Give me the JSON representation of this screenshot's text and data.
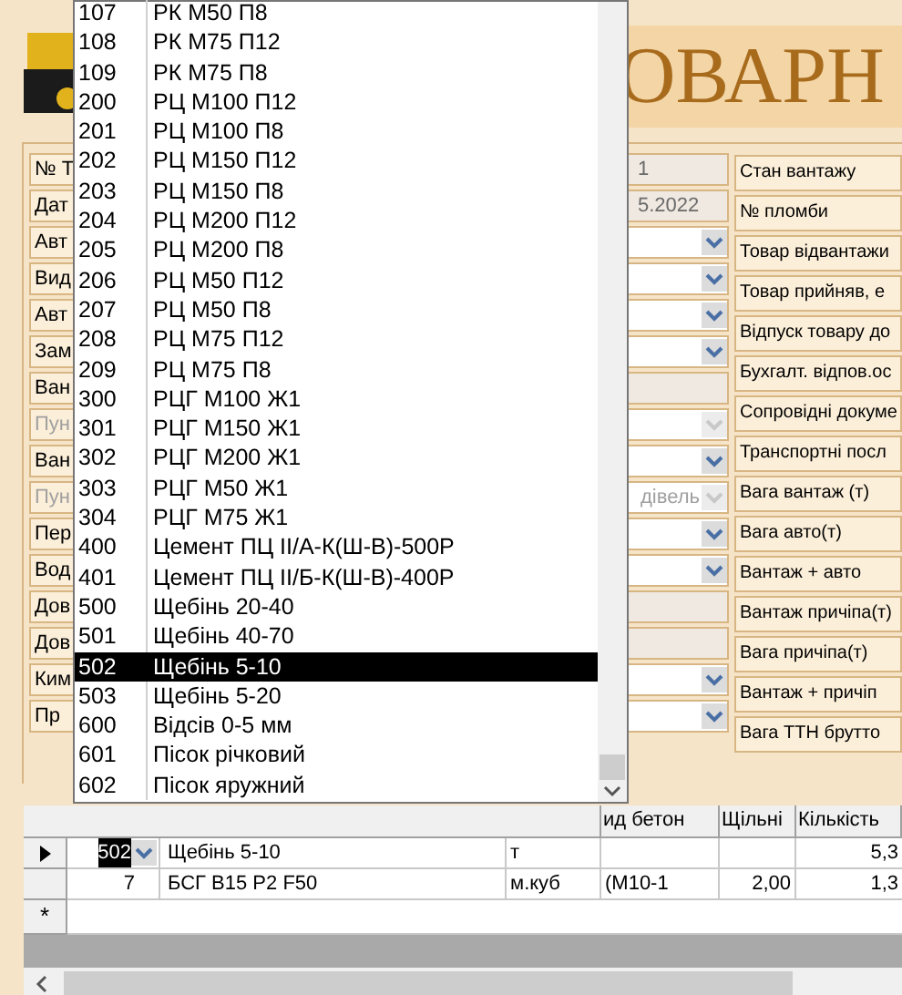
{
  "banner": {
    "title": "ОВАРН"
  },
  "form_left": [
    {
      "label": "№ Т",
      "kind": "text",
      "value": "1",
      "disabled": false
    },
    {
      "label": "Дат",
      "kind": "text",
      "value": "5.2022",
      "disabled": false
    },
    {
      "label": "Авт",
      "kind": "combo",
      "disabled": false
    },
    {
      "label": "Вид",
      "kind": "combo",
      "disabled": false
    },
    {
      "label": "Авт",
      "kind": "combo",
      "disabled": false
    },
    {
      "label": "Зам",
      "kind": "combo",
      "disabled": false
    },
    {
      "label": "Ван",
      "kind": "text",
      "disabled": false
    },
    {
      "label": "Пун",
      "kind": "combo",
      "disabled": true
    },
    {
      "label": "Ван",
      "kind": "combo",
      "disabled": false
    },
    {
      "label": "Пун",
      "kind": "combo",
      "value": "дівель",
      "disabled": true
    },
    {
      "label": "Пер",
      "kind": "combo",
      "disabled": false
    },
    {
      "label": "Вод",
      "kind": "combo",
      "disabled": false
    },
    {
      "label": "Дов",
      "kind": "text",
      "disabled": false
    },
    {
      "label": "Дов",
      "kind": "text",
      "disabled": false
    },
    {
      "label": "Ким",
      "kind": "combo",
      "disabled": false
    },
    {
      "label": "Пр",
      "kind": "combo",
      "disabled": false
    }
  ],
  "form_right": [
    "Стан вантажу",
    "№ пломби",
    "Товар відвантажи",
    "Товар прийняв, е",
    "Відпуск товару до",
    "Бухгалт. відпов.ос",
    "Сопровідні докуме",
    "Транспортні посл",
    "Вага вантаж (т)",
    "Вага авто(т)",
    "Вантаж + авто",
    "Вантаж причіпа(т)",
    "Вага причіпа(т)",
    "Вантаж + причіп",
    "Вага ТТН брутто"
  ],
  "grid": {
    "columns": [
      "ид бетон",
      "Щільні",
      "Кількість"
    ],
    "rows": [
      {
        "selected": true,
        "code": "502",
        "name": "Щебінь 5-10",
        "unit": "т",
        "grade": "",
        "density": "",
        "quantity": "5,3"
      },
      {
        "selected": false,
        "code": "7",
        "name": "БСГ В15 Р2 F50",
        "unit": "м.куб",
        "grade": "(М10-1",
        "density": "2,00",
        "quantity": "1,3"
      }
    ],
    "new_row_marker": "*"
  },
  "dropdown": {
    "items": [
      {
        "code": "107",
        "name": "РК М50 П8",
        "selected": false
      },
      {
        "code": "108",
        "name": "РК М75 П12",
        "selected": false
      },
      {
        "code": "109",
        "name": "РК М75 П8",
        "selected": false
      },
      {
        "code": "200",
        "name": "РЦ М100 П12",
        "selected": false
      },
      {
        "code": "201",
        "name": "РЦ М100 П8",
        "selected": false
      },
      {
        "code": "202",
        "name": "РЦ М150 П12",
        "selected": false
      },
      {
        "code": "203",
        "name": "РЦ М150 П8",
        "selected": false
      },
      {
        "code": "204",
        "name": "РЦ М200 П12",
        "selected": false
      },
      {
        "code": "205",
        "name": "РЦ М200 П8",
        "selected": false
      },
      {
        "code": "206",
        "name": "РЦ М50 П12",
        "selected": false
      },
      {
        "code": "207",
        "name": "РЦ М50 П8",
        "selected": false
      },
      {
        "code": "208",
        "name": "РЦ М75 П12",
        "selected": false
      },
      {
        "code": "209",
        "name": "РЦ М75 П8",
        "selected": false
      },
      {
        "code": "300",
        "name": "РЦГ М100 Ж1",
        "selected": false
      },
      {
        "code": "301",
        "name": "РЦГ М150 Ж1",
        "selected": false
      },
      {
        "code": "302",
        "name": "РЦГ М200 Ж1",
        "selected": false
      },
      {
        "code": "303",
        "name": "РЦГ М50 Ж1",
        "selected": false
      },
      {
        "code": "304",
        "name": "РЦГ М75 Ж1",
        "selected": false
      },
      {
        "code": "400",
        "name": "Цемент ПЦ ІІ/А-К(Ш-В)-500Р",
        "selected": false
      },
      {
        "code": "401",
        "name": "Цемент ПЦ ІІ/Б-К(Ш-В)-400Р",
        "selected": false
      },
      {
        "code": "500",
        "name": "Щебінь 20-40",
        "selected": false
      },
      {
        "code": "501",
        "name": "Щебінь 40-70",
        "selected": false
      },
      {
        "code": "502",
        "name": "Щебінь 5-10",
        "selected": true
      },
      {
        "code": "503",
        "name": "Щебінь 5-20",
        "selected": false
      },
      {
        "code": "600",
        "name": "Відсів 0-5 мм",
        "selected": false
      },
      {
        "code": "601",
        "name": "Пісок річковий",
        "selected": false
      },
      {
        "code": "602",
        "name": "Пісок яружний",
        "selected": false
      }
    ]
  }
}
